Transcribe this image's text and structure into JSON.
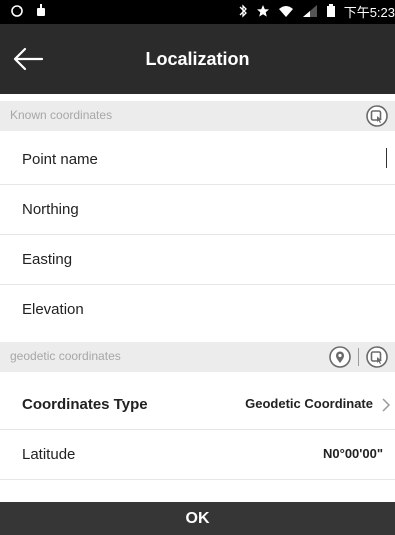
{
  "status_bar": {
    "left_icons": [
      "sync-icon",
      "android-icon"
    ],
    "right_icons": [
      "bluetooth-icon",
      "star-icon",
      "wifi-icon",
      "signal-icon",
      "battery-icon"
    ],
    "time": "下午5:23"
  },
  "app_bar": {
    "title": "Localization"
  },
  "known_section": {
    "label": "Known coordinates",
    "icons": [
      "select-point-icon"
    ]
  },
  "known_fields": [
    {
      "label": "Point name",
      "value": ""
    },
    {
      "label": "Northing",
      "value": ""
    },
    {
      "label": "Easting",
      "value": ""
    },
    {
      "label": "Elevation",
      "value": ""
    }
  ],
  "geodetic_section": {
    "label": "geodetic coordinates",
    "icons": [
      "location-pin-icon",
      "select-point-icon"
    ]
  },
  "geodetic_fields": [
    {
      "label": "Coordinates Type",
      "value": "Geodetic Coordinate",
      "has_chevron": true
    },
    {
      "label": "Latitude",
      "value": "N0°00'00\""
    }
  ],
  "footer": {
    "ok_label": "OK"
  },
  "colors": {
    "app_bar": "#2b2b2b",
    "section_bg": "#ececec",
    "ok_bar": "#363636"
  }
}
